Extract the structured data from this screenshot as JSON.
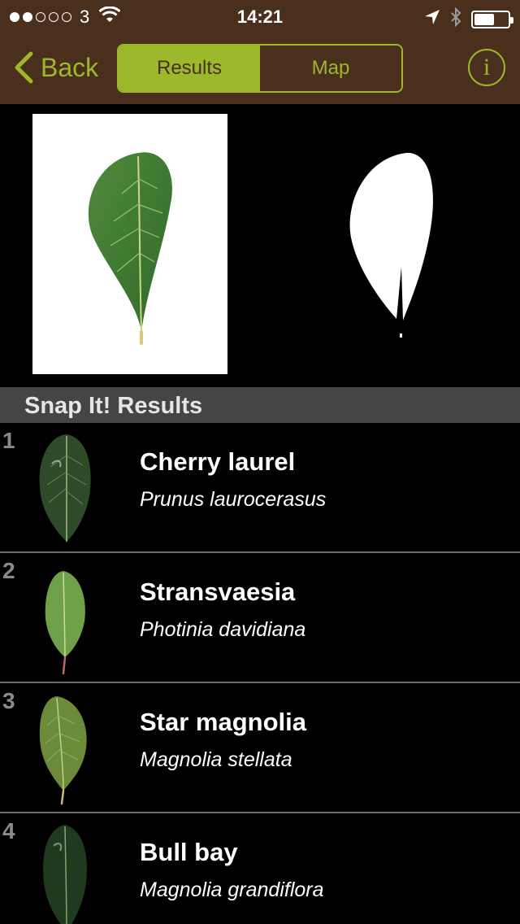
{
  "status_bar": {
    "signal_dots_filled": 2,
    "signal_dots_total": 5,
    "carrier": "3",
    "time": "14:21",
    "battery_level": 0.6
  },
  "nav": {
    "back_label": "Back",
    "segments": [
      {
        "label": "Results",
        "active": true
      },
      {
        "label": "Map",
        "active": false
      }
    ],
    "info_label": "i"
  },
  "colors": {
    "nav_bg": "#4a2f1d",
    "accent": "#9cb82b",
    "section_bg": "#454545"
  },
  "section": {
    "title": "Snap It! Results"
  },
  "results": [
    {
      "rank": "1",
      "common_name": "Cherry laurel",
      "scientific_name": "Prunus laurocerasus",
      "icon": "dark-glossy-leaf"
    },
    {
      "rank": "2",
      "common_name": "Stransvaesia",
      "scientific_name": "Photinia davidiana",
      "icon": "light-green-leaf"
    },
    {
      "rank": "3",
      "common_name": "Star magnolia",
      "scientific_name": "Magnolia stellata",
      "icon": "olive-leaf"
    },
    {
      "rank": "4",
      "common_name": "Bull bay",
      "scientific_name": "Magnolia grandiflora",
      "icon": "dark-leathery-leaf"
    }
  ]
}
